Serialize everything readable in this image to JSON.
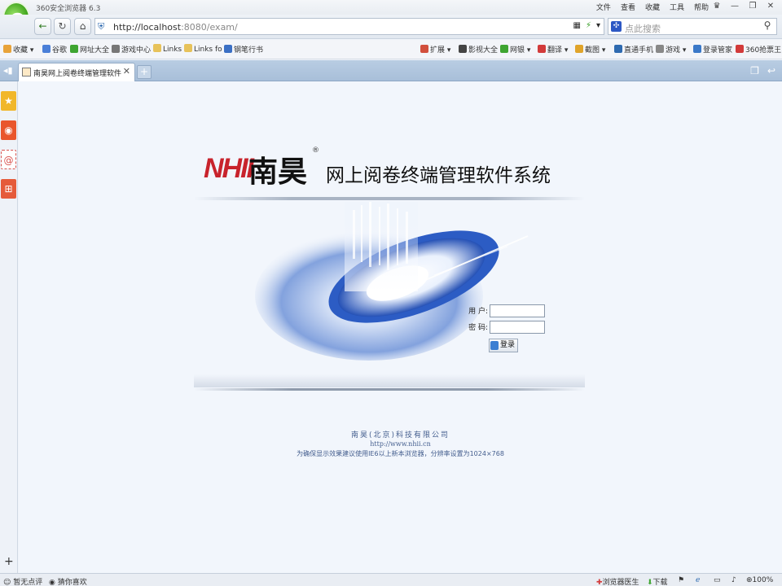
{
  "window": {
    "title": "360安全浏览器 6.3",
    "menu": [
      "文件",
      "查看",
      "收藏",
      "工具",
      "帮助"
    ],
    "controls": [
      "皮肤",
      "最小化",
      "还原",
      "关闭"
    ]
  },
  "nav": {
    "url_host": "http://localhost",
    "url_rest": ":8080/exam/",
    "search_placeholder": "点此搜索"
  },
  "bookmarks": {
    "left": [
      {
        "label": "收藏",
        "color": "#e8a33a"
      },
      {
        "label": "谷歌",
        "color": "#4a7fd8"
      },
      {
        "label": "网址大全",
        "color": "#3ea531"
      },
      {
        "label": "游戏中心",
        "color": "#777777"
      },
      {
        "label": "Links",
        "color": "#e7c25a"
      },
      {
        "label": "Links fo",
        "color": "#e7c25a"
      },
      {
        "label": "钢笔行书",
        "color": "#3a6fc4"
      }
    ],
    "right": [
      {
        "label": "扩展",
        "color": "#d14f3c"
      },
      {
        "label": "影视大全",
        "color": "#444444"
      },
      {
        "label": "网银",
        "color": "#3ea531"
      },
      {
        "label": "翻译",
        "color": "#d23a3a"
      },
      {
        "label": "截图",
        "color": "#e0a42a"
      },
      {
        "label": "直通手机",
        "color": "#2e6ab0"
      },
      {
        "label": "游戏",
        "color": "#888888"
      },
      {
        "label": "登录管家",
        "color": "#3a78c8"
      },
      {
        "label": "360抢票王",
        "color": "#d23a3a"
      }
    ]
  },
  "tab": {
    "title": "南昊网上阅卷终端管理软件系统"
  },
  "page": {
    "brand_latin": "NHII",
    "brand_cn": "南昊",
    "brand_reg": "®",
    "system_name": "网上阅卷终端管理软件系统",
    "user_label": "用 户:",
    "password_label": "密 码:",
    "user_value": "",
    "password_value": "",
    "login_label": "登录",
    "company": "南昊(北京)科技有限公司",
    "website": "http://www.nhii.cn",
    "tip": "为确保显示效果建议使用IE6以上新本浏览器，分辨率设置为1024×768"
  },
  "status": {
    "left1": "暂无点评",
    "left2": "猜你喜欢",
    "doctor": "浏览器医生",
    "download": "下载",
    "zoom": "100%"
  }
}
